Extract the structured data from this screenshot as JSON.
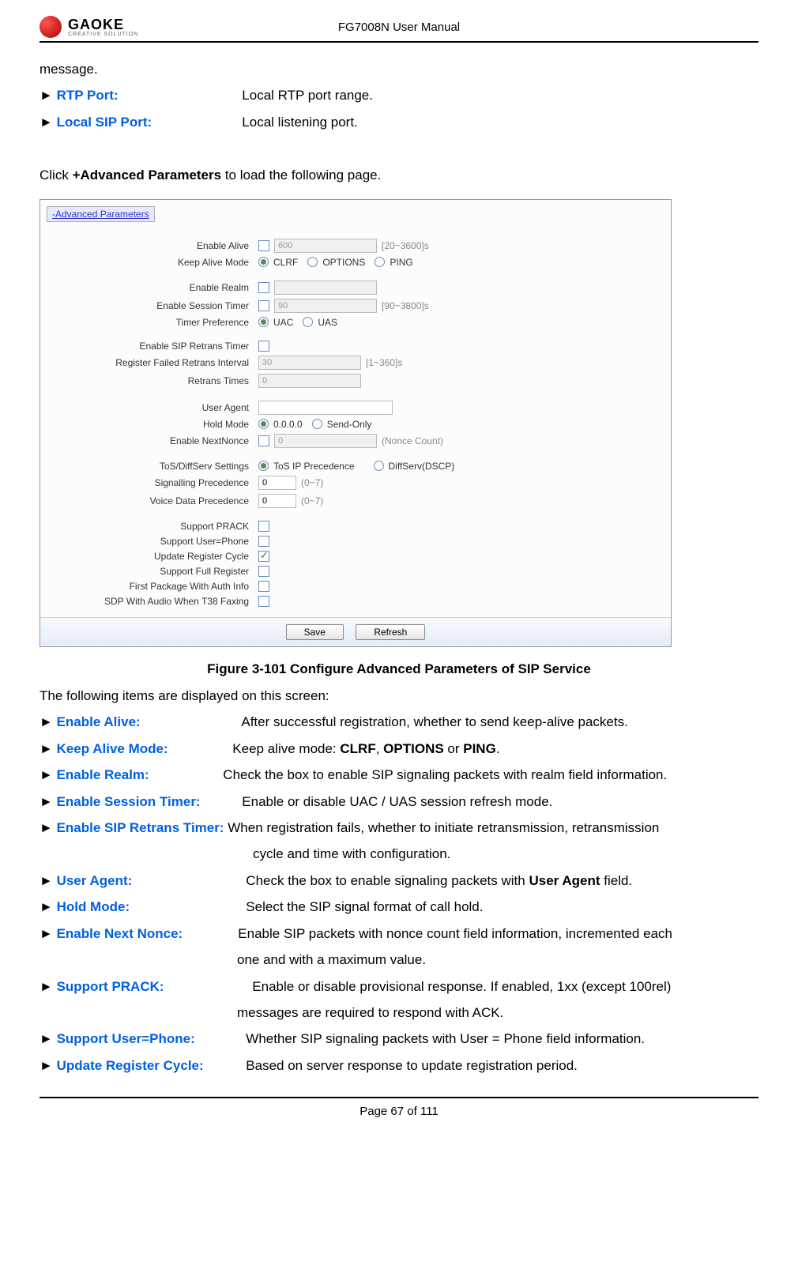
{
  "header": {
    "logo_text": "GAOKE",
    "logo_sub": "CREATIVE SOLUTION",
    "doc_title": "FG7008N User Manual"
  },
  "intro": {
    "line1": "message.",
    "rtp_label": "RTP Port:",
    "rtp_desc": "Local RTP port range.",
    "lsp_label": "Local SIP Port:",
    "lsp_desc": "Local listening port.",
    "click_line_pre": "Click ",
    "click_line_bold": "+Advanced Parameters",
    "click_line_post": " to load the following page."
  },
  "shot": {
    "link_label": "-Advanced Parameters",
    "rows": {
      "enable_alive": "Enable Alive",
      "enable_alive_val": "600",
      "enable_alive_hint": "[20~3600]s",
      "keep_alive_mode": "Keep Alive Mode",
      "kam_opt1": "CLRF",
      "kam_opt2": "OPTIONS",
      "kam_opt3": "PING",
      "enable_realm": "Enable Realm",
      "enable_session_timer": "Enable Session Timer",
      "est_val": "90",
      "est_hint": "[90~3800]s",
      "timer_pref": "Timer Preference",
      "tp_opt1": "UAC",
      "tp_opt2": "UAS",
      "enable_sip_retrans": "Enable SIP Retrans Timer",
      "reg_failed_retrans": "Register Failed Retrans Interval",
      "rfr_val": "30",
      "rfr_hint": "[1~360]s",
      "retrans_times": "Retrans Times",
      "rt_val": "0",
      "user_agent": "User Agent",
      "hold_mode": "Hold Mode",
      "hm_opt1": "0.0.0.0",
      "hm_opt2": "Send-Only",
      "enable_nextnonce": "Enable NextNonce",
      "nn_val": "0",
      "nn_hint": "(Nonce Count)",
      "tos_settings": "ToS/DiffServ Settings",
      "tos_opt1": "ToS IP Precedence",
      "tos_opt2": "DiffServ(DSCP)",
      "sig_prec": "Signalling Precedence",
      "sig_val": "0",
      "sig_hint": "(0~7)",
      "voice_prec": "Voice Data Precedence",
      "voice_val": "0",
      "voice_hint": "(0~7)",
      "support_prack": "Support PRACK",
      "support_userphone": "Support User=Phone",
      "update_reg_cycle": "Update Register Cycle",
      "support_full_reg": "Support Full Register",
      "first_pkg_auth": "First Package With Auth Info",
      "sdp_audio_t38": "SDP With Audio When T38 Faxing"
    },
    "btn_save": "Save",
    "btn_refresh": "Refresh"
  },
  "caption": "Figure 3-101 Configure Advanced Parameters of SIP Service",
  "desc_intro": "The following items are displayed on this screen:",
  "params": {
    "enable_alive_lbl": "Enable Alive:",
    "enable_alive_desc": "After successful registration, whether to send keep-alive packets.",
    "keep_alive_lbl": "Keep Alive Mode:",
    "keep_alive_desc_pre": "Keep alive mode: ",
    "keep_alive_b1": "CLRF",
    "keep_alive_sep": ", ",
    "keep_alive_b2": "OPTIONS",
    "keep_alive_or": " or ",
    "keep_alive_b3": "PING",
    "keep_alive_end": ".",
    "enable_realm_lbl": "Enable Realm:",
    "enable_realm_desc": "Check the box to enable SIP signaling packets with realm field information.",
    "est_lbl": "Enable Session Timer:",
    "est_desc": "Enable or disable UAC / UAS session refresh mode.",
    "esrt_lbl": "Enable SIP Retrans Timer:",
    "esrt_desc1": "When registration fails, whether to initiate retransmission, retransmission",
    "esrt_desc2": "cycle and time with configuration.",
    "ua_lbl": "User Agent:",
    "ua_desc_pre": "Check the box to enable signaling packets with ",
    "ua_b": "User Agent",
    "ua_desc_post": " field.",
    "hold_lbl": "Hold Mode:",
    "hold_desc": "Select the SIP signal format of call hold.",
    "enn_lbl": "Enable Next Nonce:",
    "enn_desc1": "Enable SIP packets with nonce count field information, incremented each",
    "enn_desc2": "one and with a maximum value.",
    "prack_lbl": "Support PRACK:",
    "prack_desc1": "Enable or disable provisional response. If enabled, 1xx (except 100rel)",
    "prack_desc2": "messages are required to respond with ACK.",
    "sup_lbl": "Support User=Phone:",
    "sup_desc": "Whether SIP signaling packets with User = Phone field information.",
    "urc_lbl": "Update Register Cycle:",
    "urc_desc": "Based on server response to update registration period."
  },
  "footer": "Page 67 of 111"
}
